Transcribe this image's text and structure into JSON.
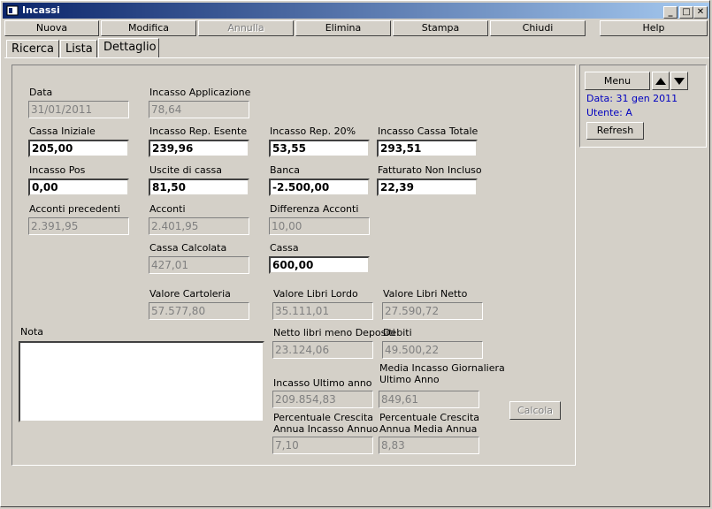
{
  "window": {
    "title": "Incassi"
  },
  "controls": {
    "minimize": "_",
    "maximize": "□",
    "close": "✕"
  },
  "toolbar": {
    "nuova": "Nuova",
    "modifica": "Modifica",
    "annulla": "Annulla",
    "elimina": "Elimina",
    "stampa": "Stampa",
    "chiudi": "Chiudi",
    "help": "Help"
  },
  "tabs": {
    "ricerca": "Ricerca",
    "lista": "Lista",
    "dettaglio": "Dettaglio"
  },
  "form": {
    "data": {
      "label": "Data",
      "value": "31/01/2011"
    },
    "incasso_applicazione": {
      "label": "Incasso Applicazione",
      "value": "78,64"
    },
    "cassa_iniziale": {
      "label": "Cassa Iniziale",
      "value": "205,00"
    },
    "incasso_rep_esente": {
      "label": "Incasso Rep. Esente",
      "value": "239,96"
    },
    "incasso_rep_20": {
      "label": "Incasso Rep. 20%",
      "value": "53,55"
    },
    "incasso_cassa_totale": {
      "label": "Incasso Cassa Totale",
      "value": "293,51"
    },
    "incasso_pos": {
      "label": "Incasso Pos",
      "value": "0,00"
    },
    "uscite_di_cassa": {
      "label": "Uscite di cassa",
      "value": "81,50"
    },
    "banca": {
      "label": "Banca",
      "value": "-2.500,00"
    },
    "fatturato_non_incluso": {
      "label": "Fatturato Non Incluso",
      "value": "22,39"
    },
    "acconti_precedenti": {
      "label": "Acconti precedenti",
      "value": "2.391,95"
    },
    "acconti": {
      "label": "Acconti",
      "value": "2.401,95"
    },
    "differenza_acconti": {
      "label": "Differenza Acconti",
      "value": "10,00"
    },
    "cassa_calcolata": {
      "label": "Cassa Calcolata",
      "value": "427,01"
    },
    "cassa": {
      "label": "Cassa",
      "value": "600,00"
    },
    "valore_cartoleria": {
      "label": "Valore Cartoleria",
      "value": "57.577,80"
    },
    "valore_libri_lordo": {
      "label": "Valore Libri Lordo",
      "value": "35.111,01"
    },
    "valore_libri_netto": {
      "label": "Valore Libri Netto",
      "value": "27.590,72"
    },
    "nota": {
      "label": "Nota",
      "value": ""
    },
    "netto_libri_meno_depositi": {
      "label": "Netto libri meno Depositi",
      "value": "23.124,06"
    },
    "debiti": {
      "label": "Debiti",
      "value": "49.500,22"
    },
    "incasso_ultimo_anno": {
      "label": "Incasso Ultimo anno",
      "value": "209.854,83"
    },
    "media_incasso_giornaliera": {
      "label_line1": "Media Incasso Giornaliera",
      "label_line2": "Ultimo Anno",
      "value": "849,61"
    },
    "perc_crescita_incasso": {
      "label_line1": "Percentuale Crescita",
      "label_line2": "Annua Incasso Annuo",
      "value": "7,10"
    },
    "perc_crescita_media": {
      "label_line1": "Percentuale Crescita",
      "label_line2": "Annua Media Annua",
      "value": "8,83"
    },
    "calcola": "Calcola"
  },
  "side": {
    "menu": "Menu",
    "data_text": "Data: 31 gen 2011",
    "utente_text": "Utente: A",
    "refresh": "Refresh"
  }
}
